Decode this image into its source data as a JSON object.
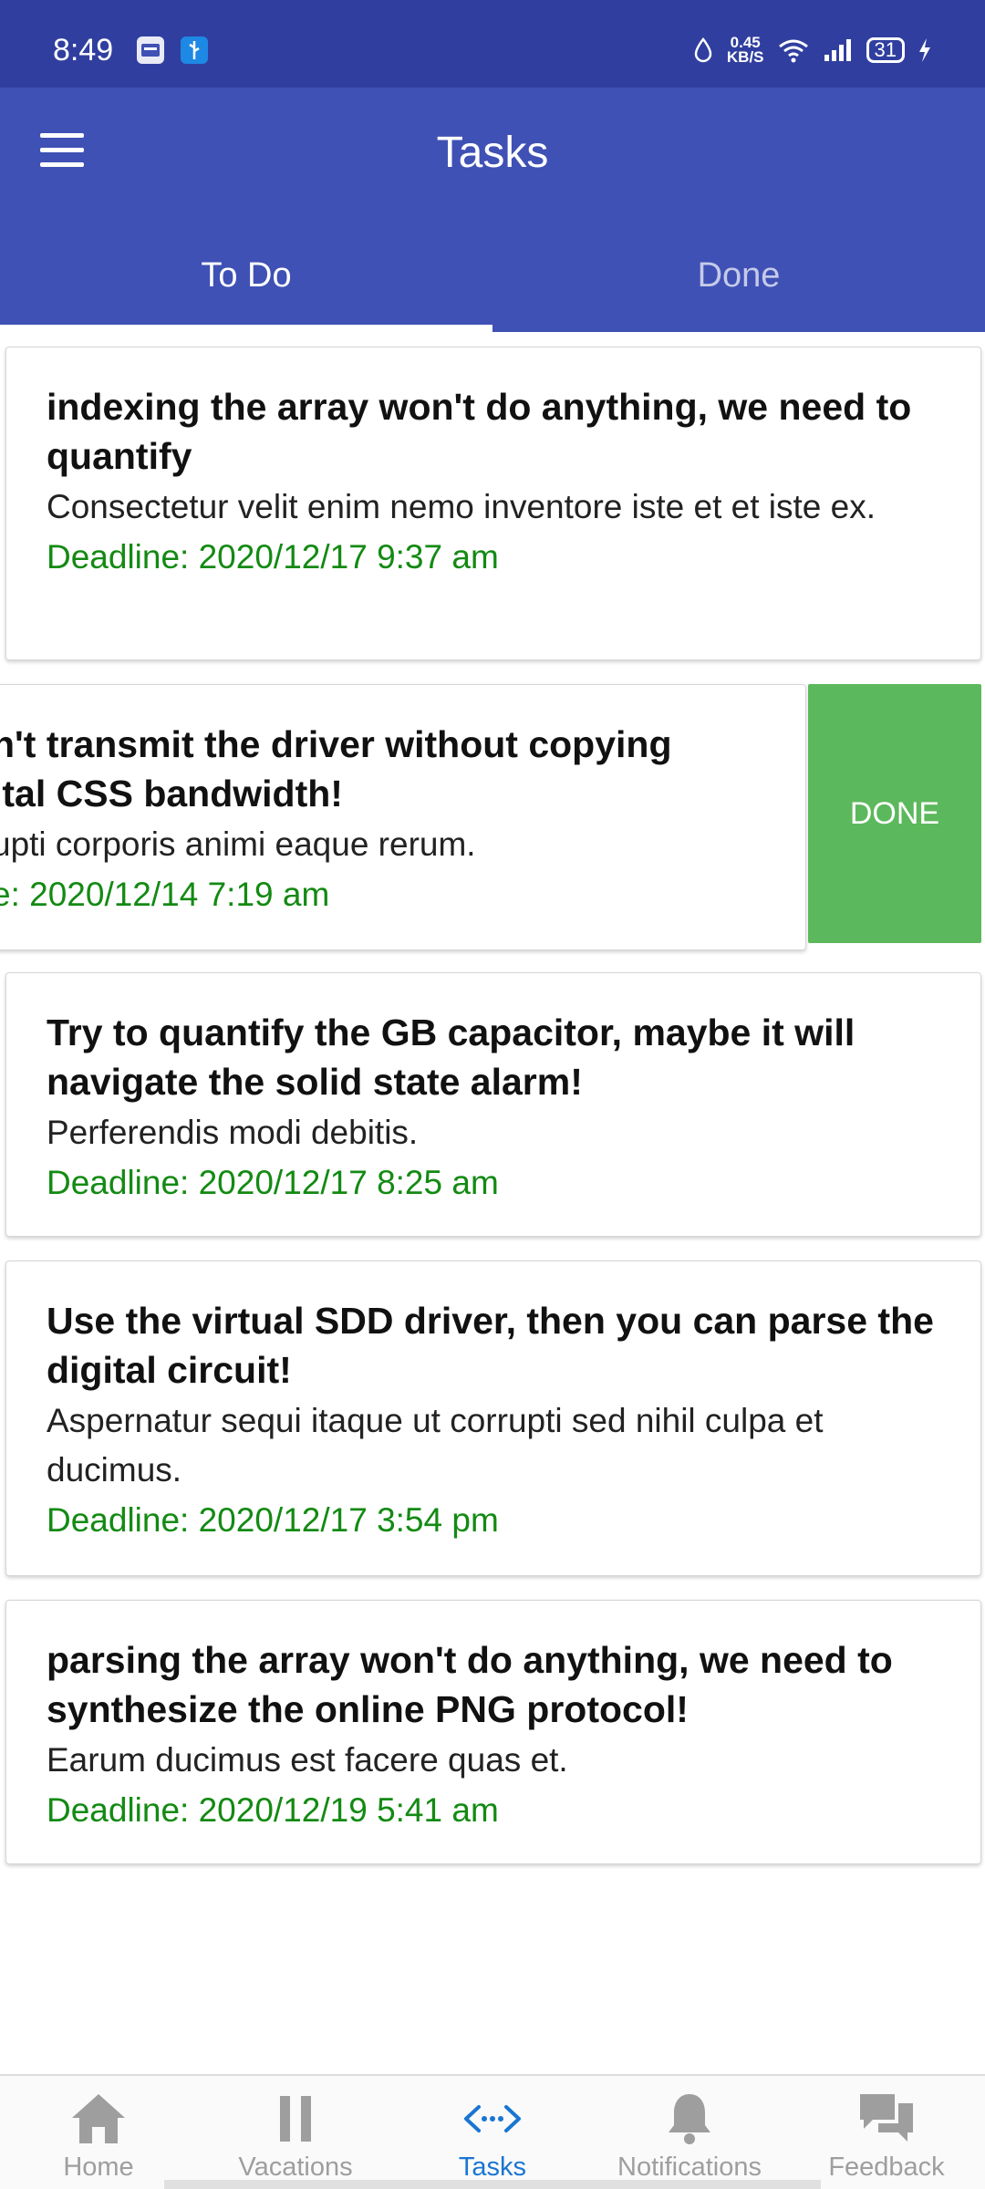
{
  "status_bar": {
    "time": "8:49",
    "net_speed_value": "0.45",
    "net_speed_unit": "KB/S",
    "battery": "31"
  },
  "app_bar": {
    "title": "Tasks",
    "menu_icon": "hamburger-menu-icon"
  },
  "tabs": [
    {
      "label": "To Do",
      "active": true
    },
    {
      "label": "Done",
      "active": false
    }
  ],
  "tasks": [
    {
      "title": "indexing the array won't do anything, we need to quantify",
      "description": "Consectetur velit enim nemo inventore iste et et iste ex.",
      "deadline": "Deadline: 2020/12/17 9:37 am"
    },
    {
      "title_line1": "n't transmit the driver without copying",
      "title_line2": "ital CSS bandwidth!",
      "description": "upti corporis animi eaque rerum.",
      "deadline": "e: 2020/12/14 7:19 am",
      "swipe_action": "DONE"
    },
    {
      "title": "Try to quantify the GB capacitor, maybe it will navigate the solid state alarm!",
      "description": "Perferendis modi debitis.",
      "deadline": "Deadline: 2020/12/17 8:25 am"
    },
    {
      "title": "Use the virtual SDD driver, then you can parse the digital circuit!",
      "description": "Aspernatur sequi itaque ut corrupti sed nihil culpa et ducimus.",
      "deadline": "Deadline: 2020/12/17 3:54 pm"
    },
    {
      "title": "parsing the array won't do anything, we need to synthesize the online PNG protocol!",
      "description": "Earum ducimus est facere quas et.",
      "deadline": "Deadline: 2020/12/19 5:41 am"
    }
  ],
  "bottom_nav": [
    {
      "label": "Home",
      "icon": "home-icon"
    },
    {
      "label": "Vacations",
      "icon": "pause-icon"
    },
    {
      "label": "Tasks",
      "icon": "code-arrows-icon",
      "active": true
    },
    {
      "label": "Notifications",
      "icon": "bell-icon"
    },
    {
      "label": "Feedback",
      "icon": "chat-bubbles-icon"
    }
  ],
  "colors": {
    "primary": "#3f51b5",
    "status_bar": "#303f9f",
    "deadline": "#138a13",
    "done_action": "#5cb85c",
    "nav_active": "#1976d2"
  }
}
